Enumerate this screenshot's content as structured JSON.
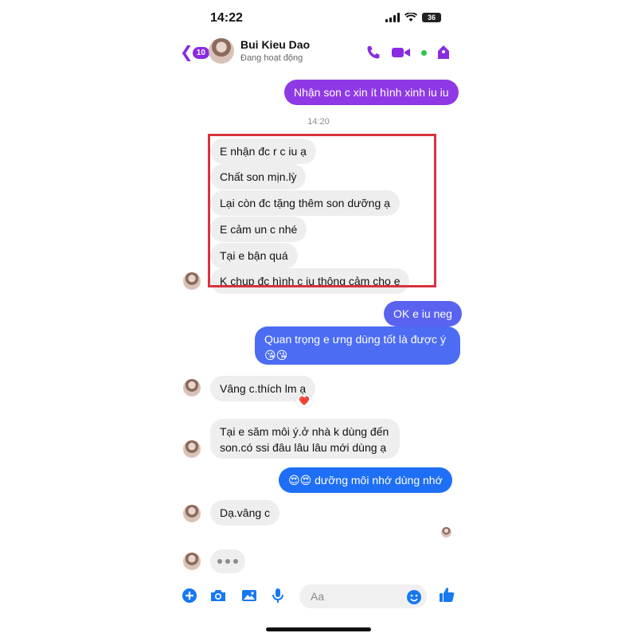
{
  "status": {
    "time": "14:22",
    "battery": "36"
  },
  "header": {
    "back_count": "10",
    "contact_name": "Bui Kieu Dao",
    "contact_status": "Đang hoạt động"
  },
  "messages": {
    "m0": "Nhận son c xin ít hình xinh iu iu",
    "timestamp": "14:20",
    "m1": "E nhận đc r c iu ạ",
    "m2": "Chất son mịn.lỳ",
    "m3": "Lại còn đc tặng thêm son dưỡng ạ",
    "m4": "E cảm un c nhé",
    "m5": "Tại e bận quá",
    "m6": "K chụp đc hình c iu thông cảm cho e",
    "m7": "OK e iu neg",
    "m8_line1": "Quan trọng e ưng dùng tốt là được ý",
    "m8_line2": "😘😘",
    "m9": "Vâng c.thích lm ạ",
    "m9_reaction": "❤️",
    "m10_line1": "Tại e săm môi ý.ở nhà k dùng đến",
    "m10_line2": "son.có ssi đâu lâu lâu mới dùng ạ",
    "m11": "😍😍 dưỡng môi nhớ dùng nhớ",
    "m12": "Dạ.vâng c"
  },
  "composer": {
    "placeholder": "Aa"
  },
  "colors": {
    "purple": "#8a2be2",
    "blue": "#1778f2",
    "highlight": "#d8333f"
  },
  "icons": [
    "chevron-left-icon",
    "phone-icon",
    "video-icon",
    "tag-icon",
    "plus-icon",
    "camera-icon",
    "image-icon",
    "mic-icon",
    "emoji-icon",
    "thumbs-up-icon"
  ]
}
